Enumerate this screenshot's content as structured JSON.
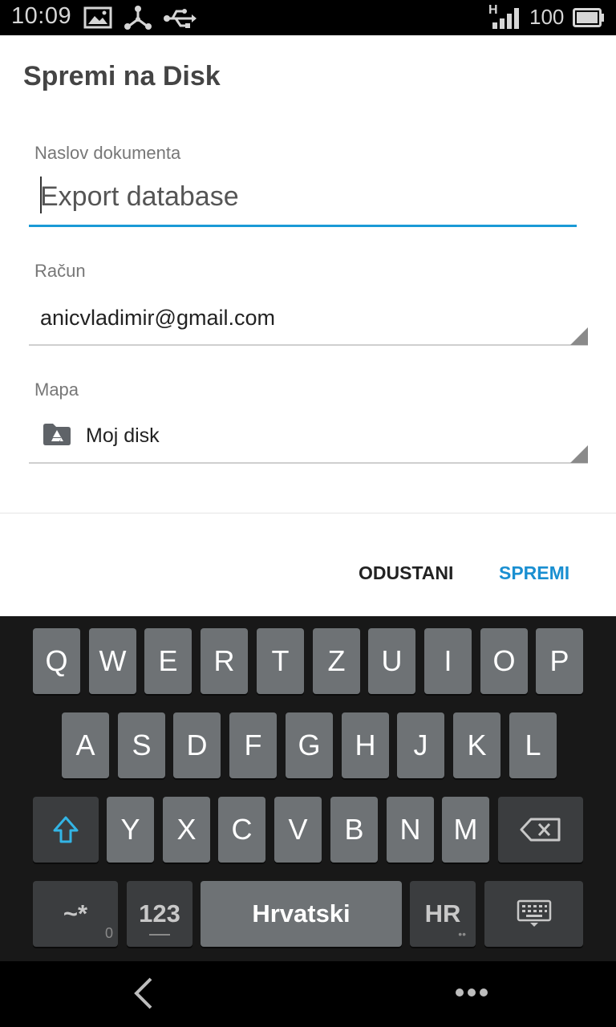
{
  "status_bar": {
    "time": "10:09",
    "network_type": "H",
    "battery_percent": "100",
    "icons": [
      "image-icon",
      "share-network-icon",
      "usb-icon",
      "signal-icon",
      "battery-icon"
    ]
  },
  "dialog": {
    "title": "Spremi na Disk",
    "document_title_label": "Naslov dokumenta",
    "document_title_value": "Export database",
    "account_label": "Račun",
    "account_value": "anicvladimir@gmail.com",
    "folder_label": "Mapa",
    "folder_value": "Moj disk",
    "cancel_label": "ODUSTANI",
    "save_label": "SPREMI",
    "accent_color": "#1a9ad6"
  },
  "keyboard": {
    "row1": [
      "Q",
      "W",
      "E",
      "R",
      "T",
      "Z",
      "U",
      "I",
      "O",
      "P"
    ],
    "row2": [
      "A",
      "S",
      "D",
      "F",
      "G",
      "H",
      "J",
      "K",
      "L"
    ],
    "row3": [
      "Y",
      "X",
      "C",
      "V",
      "B",
      "N",
      "M"
    ],
    "symbols_label": "~*",
    "symbols_hint": "0",
    "numbers_label": "123",
    "space_label": "Hrvatski",
    "language_label": "HR",
    "icons": [
      "shift-icon",
      "backspace-icon",
      "keyboard-hide-icon"
    ]
  },
  "navigation": {
    "icons": [
      "back-icon",
      "more-icon"
    ]
  }
}
